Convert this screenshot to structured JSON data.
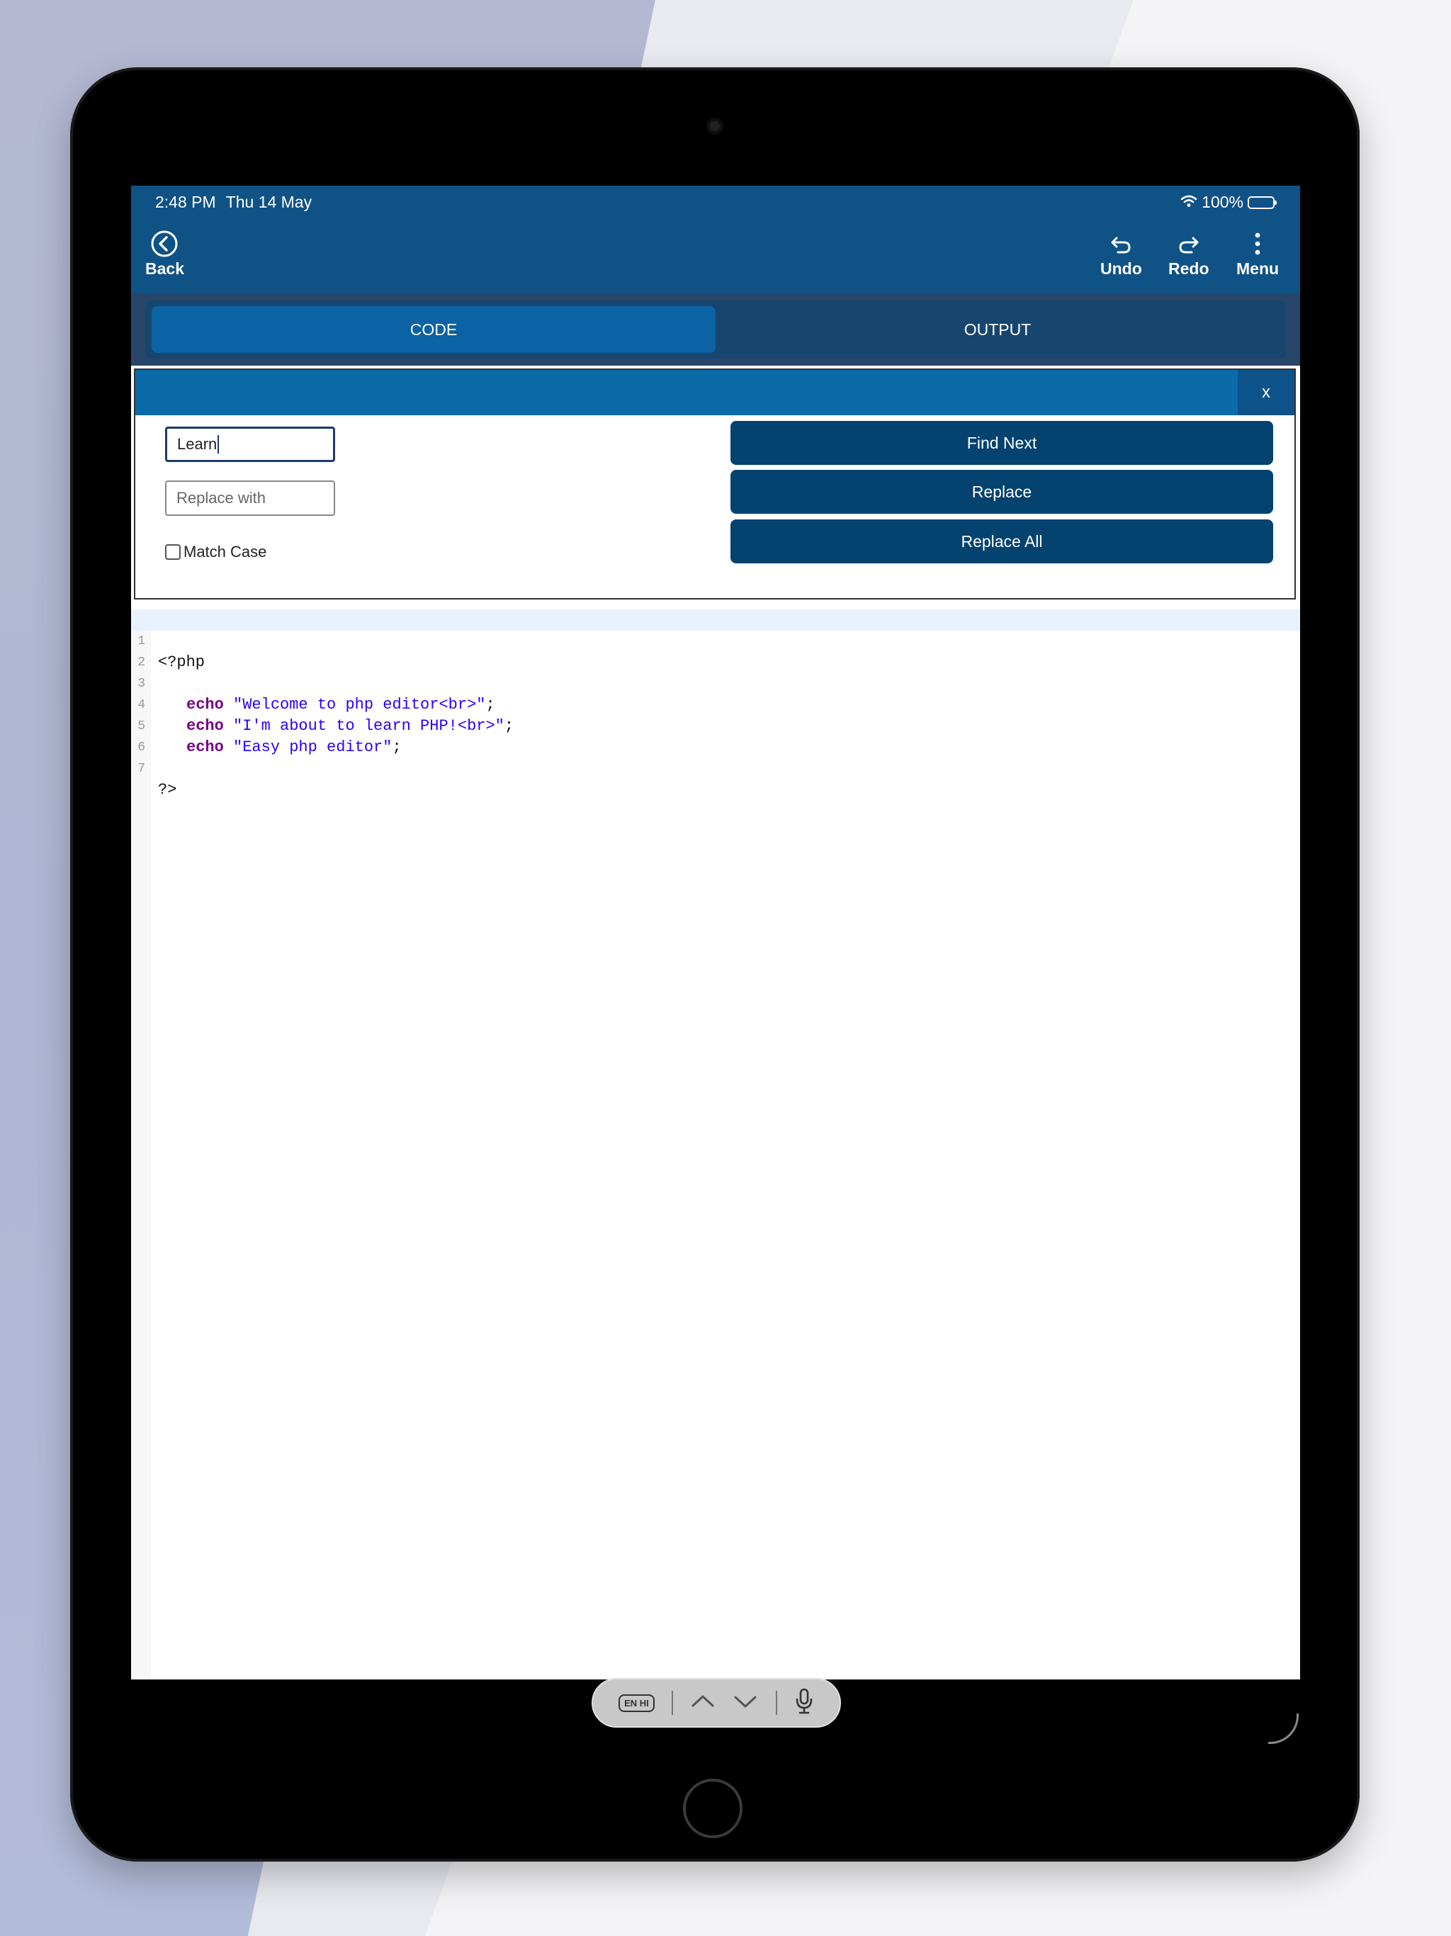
{
  "status_bar": {
    "time": "2:48 PM",
    "date": "Thu 14 May",
    "battery": "100%"
  },
  "toolbar": {
    "back_label": "Back",
    "undo_label": "Undo",
    "redo_label": "Redo",
    "menu_label": "Menu"
  },
  "tabs": [
    {
      "label": "CODE",
      "active": true
    },
    {
      "label": "OUTPUT",
      "active": false
    }
  ],
  "find_panel": {
    "close_label": "x",
    "find_value": "Learn",
    "replace_placeholder": "Replace with",
    "match_case_label": "Match Case",
    "find_next_label": "Find Next",
    "replace_label": "Replace",
    "replace_all_label": "Replace All"
  },
  "editor": {
    "line_numbers": [
      "1",
      "2",
      "3",
      "4",
      "5",
      "6",
      "7"
    ],
    "line1": "<?php",
    "echo_keyword": "echo",
    "line3_string": "\"Welcome to php editor<br>\"",
    "line4_string": "\"I'm about to learn PHP!<br>\"",
    "line5_string": "\"Easy php editor\"",
    "semicolon": ";",
    "line7": "?>"
  },
  "keyboard_bar": {
    "language_label": "EN HI"
  },
  "colors": {
    "accent": "#0f5286",
    "active_tab": "#0b62a4",
    "button": "#04426f",
    "keyword": "#770088",
    "string": "#2a00ff"
  }
}
